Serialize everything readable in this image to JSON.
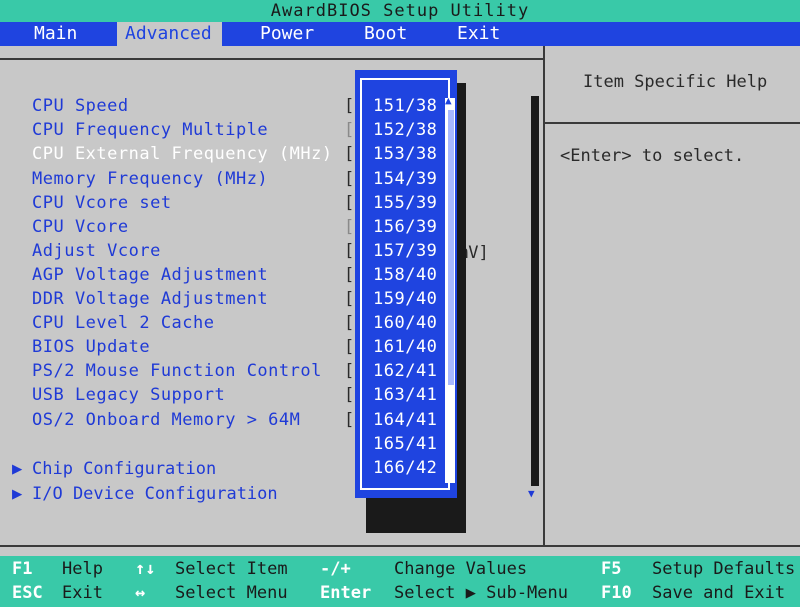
{
  "title": "AwardBIOS Setup Utility",
  "menu": [
    {
      "label": "Main",
      "active": false
    },
    {
      "label": "Advanced",
      "active": true
    },
    {
      "label": "Power",
      "active": false
    },
    {
      "label": "Boot",
      "active": false
    },
    {
      "label": "Exit",
      "active": false
    }
  ],
  "settings": [
    {
      "label": "CPU Speed",
      "bracket": "["
    },
    {
      "label": "CPU Frequency Multiple",
      "bracket": "["
    },
    {
      "label": "CPU External Frequency (MHz)",
      "bracket": "[",
      "selected": true
    },
    {
      "label": "Memory Frequency (MHz)",
      "bracket": "["
    },
    {
      "label": "CPU Vcore set",
      "bracket": "["
    },
    {
      "label": "CPU Vcore",
      "bracket": "["
    },
    {
      "label": "Adjust Vcore",
      "bracket": "["
    },
    {
      "label": "AGP Voltage Adjustment",
      "bracket": "["
    },
    {
      "label": "DDR Voltage Adjustment",
      "bracket": "["
    },
    {
      "label": "CPU Level 2 Cache",
      "bracket": "["
    },
    {
      "label": "BIOS Update",
      "bracket": "["
    },
    {
      "label": "PS/2 Mouse Function Control",
      "bracket": "["
    },
    {
      "label": "USB Legacy Support",
      "bracket": "["
    },
    {
      "label": "OS/2 Onboard Memory > 64M",
      "bracket": "["
    }
  ],
  "adjust_vcore_partial": "mV]",
  "submenus": [
    {
      "label": "Chip Configuration"
    },
    {
      "label": "I/O Device Configuration"
    }
  ],
  "popup_options": [
    "151/38",
    "152/38",
    "153/38",
    "154/39",
    "155/39",
    "156/39",
    "157/39",
    "158/40",
    "159/40",
    "160/40",
    "161/40",
    "162/41",
    "163/41",
    "164/41",
    "165/41",
    "166/42"
  ],
  "help": {
    "title": "Item Specific Help",
    "text": "<Enter> to select."
  },
  "footer": {
    "row1": [
      {
        "key": "F1",
        "desc": "Help"
      },
      {
        "key": "↑↓",
        "desc": "Select Item"
      },
      {
        "key": "-/+",
        "desc": "Change Values"
      },
      {
        "key": "F5",
        "desc": "Setup Defaults"
      }
    ],
    "row2": [
      {
        "key": "ESC",
        "desc": "Exit"
      },
      {
        "key": "↔",
        "desc": "Select Menu"
      },
      {
        "key": "Enter",
        "desc": "Select ▶ Sub-Menu"
      },
      {
        "key": "F10",
        "desc": "Save and Exit"
      }
    ]
  },
  "colors": {
    "bios_blue": "#1f44e0",
    "teal": "#39c9a8",
    "panel_gray": "#c8c8c8"
  }
}
